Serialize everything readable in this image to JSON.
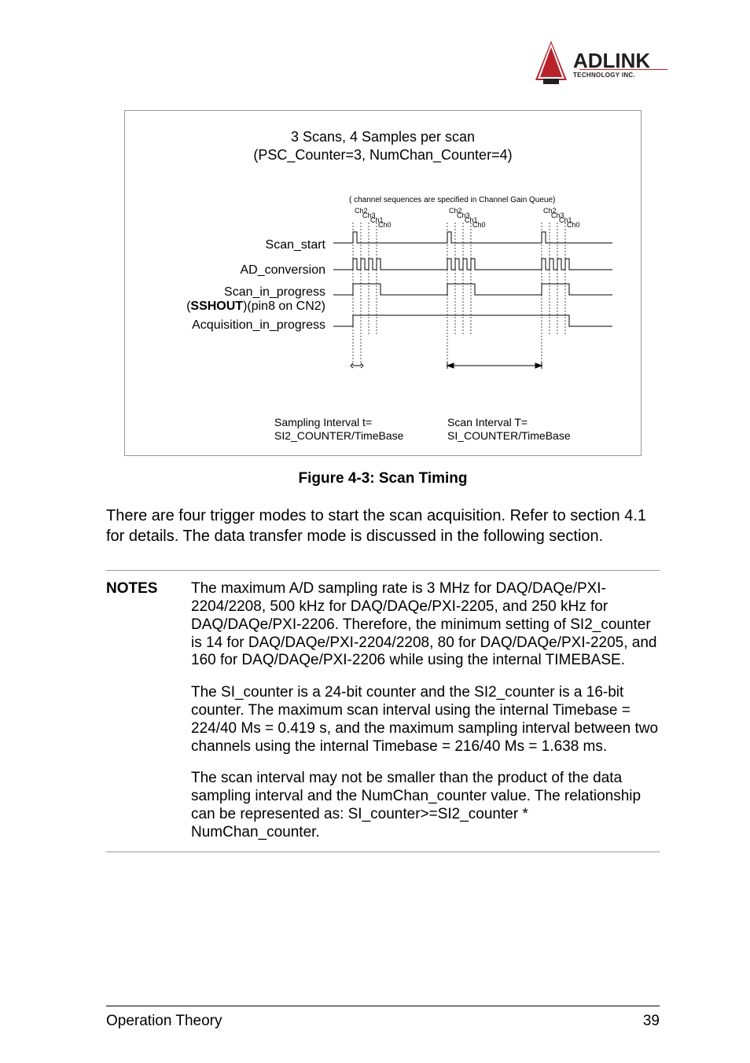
{
  "logo": {
    "brand": "ADLINK",
    "tagline": "TECHNOLOGY INC."
  },
  "figure": {
    "title_line1": "3 Scans, 4 Samples per scan",
    "title_line2": "(PSC_Counter=3, NumChan_Counter=4)",
    "channel_note": "( channel sequences are specified in Channel Gain Queue)",
    "ch_labels": [
      "Ch2",
      "Ch3",
      "Ch1",
      "Ch0"
    ],
    "signals": {
      "scan_start": "Scan_start",
      "ad_conversion": "AD_conversion",
      "scan_in_progress_l1": "Scan_in_progress",
      "scan_in_progress_l2_bold": "SSHOUT",
      "scan_in_progress_l2_rest": ")(pin8 on CN2)",
      "acquisition": "Acquisition_in_progress"
    },
    "bottom_left_l1": "Sampling Interval t=",
    "bottom_left_l2": "SI2_COUNTER/TimeBase",
    "bottom_right_l1": "Scan Interval T=",
    "bottom_right_l2": "SI_COUNTER/TimeBase",
    "caption": "Figure 4-3: Scan Timing"
  },
  "paragraph": "There are four trigger modes to start the scan acquisition. Refer to section 4.1 for details. The data transfer mode is discussed in the following section.",
  "notes": {
    "label": "NOTES",
    "p1": "The maximum A/D sampling rate is 3 MHz for DAQ/DAQe/PXI-2204/2208, 500 kHz for DAQ/DAQe/PXI-2205, and 250 kHz for DAQ/DAQe/PXI-2206. Therefore, the minimum setting of SI2_counter is 14 for DAQ/DAQe/PXI-2204/2208, 80 for DAQ/DAQe/PXI-2205, and 160 for DAQ/DAQe/PXI-2206 while using the internal TIMEBASE.",
    "p2": "The SI_counter is a 24-bit counter and the SI2_counter is a 16-bit counter. The maximum scan interval using the internal Timebase = 224/40 Ms = 0.419 s, and the maximum sampling interval between two channels using the internal Timebase = 216/40 Ms = 1.638 ms.",
    "p3": "The scan interval may not be smaller than the product of the data sampling interval and the NumChan_counter value. The relationship can be represented as: SI_counter>=SI2_counter * NumChan_counter."
  },
  "footer": {
    "section": "Operation Theory",
    "page": "39"
  },
  "chart_data": {
    "type": "timing_diagram",
    "title": "Scan Timing",
    "num_scans": 3,
    "samples_per_scan": 4,
    "psc_counter": 3,
    "numchan_counter": 4,
    "channel_order": [
      "Ch2",
      "Ch3",
      "Ch1",
      "Ch0"
    ],
    "signals": [
      {
        "name": "Scan_start",
        "pulses": 3,
        "description": "rising pulse at start of each scan"
      },
      {
        "name": "AD_conversion",
        "pulses_per_scan": 4,
        "scans": 3,
        "description": "one pulse per sample"
      },
      {
        "name": "Scan_in_progress (SSHOUT, pin8 on CN2)",
        "high_during": "each scan's 4 samples"
      },
      {
        "name": "Acquisition_in_progress",
        "high_during": "all 3 scans"
      }
    ],
    "intervals": {
      "sampling_interval": "t = SI2_COUNTER/TimeBase",
      "scan_interval": "T = SI_COUNTER/TimeBase"
    }
  }
}
